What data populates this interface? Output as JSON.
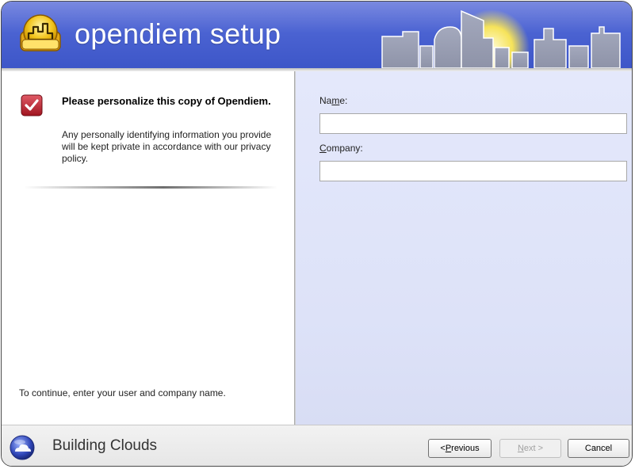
{
  "app": {
    "title": "opendiem setup",
    "colors": {
      "header": "#4b63d2",
      "right_pane": "#e0e4f9",
      "accent_yellow": "#f2c41b",
      "check_red": "#b8202e"
    }
  },
  "intro": {
    "heading": "Please personalize this copy of Opendiem.",
    "description": "Any personally identifying information you provide will be kept private in accordance with our privacy policy.",
    "icon": "checkbox-check-icon"
  },
  "form": {
    "name_label_pre": "Na",
    "name_label_ul": "m",
    "name_label_post": "e:",
    "name_value": "",
    "company_label_pre": "",
    "company_label_ul": "C",
    "company_label_post": "ompany:",
    "company_value": ""
  },
  "footer_hint": "To continue, enter your user and company name.",
  "bottom": {
    "brand": "Building Clouds",
    "prev_pre": "< ",
    "prev_ul": "P",
    "prev_post": "revious",
    "next_pre": "",
    "next_ul": "N",
    "next_post": "ext >",
    "cancel": "Cancel"
  }
}
